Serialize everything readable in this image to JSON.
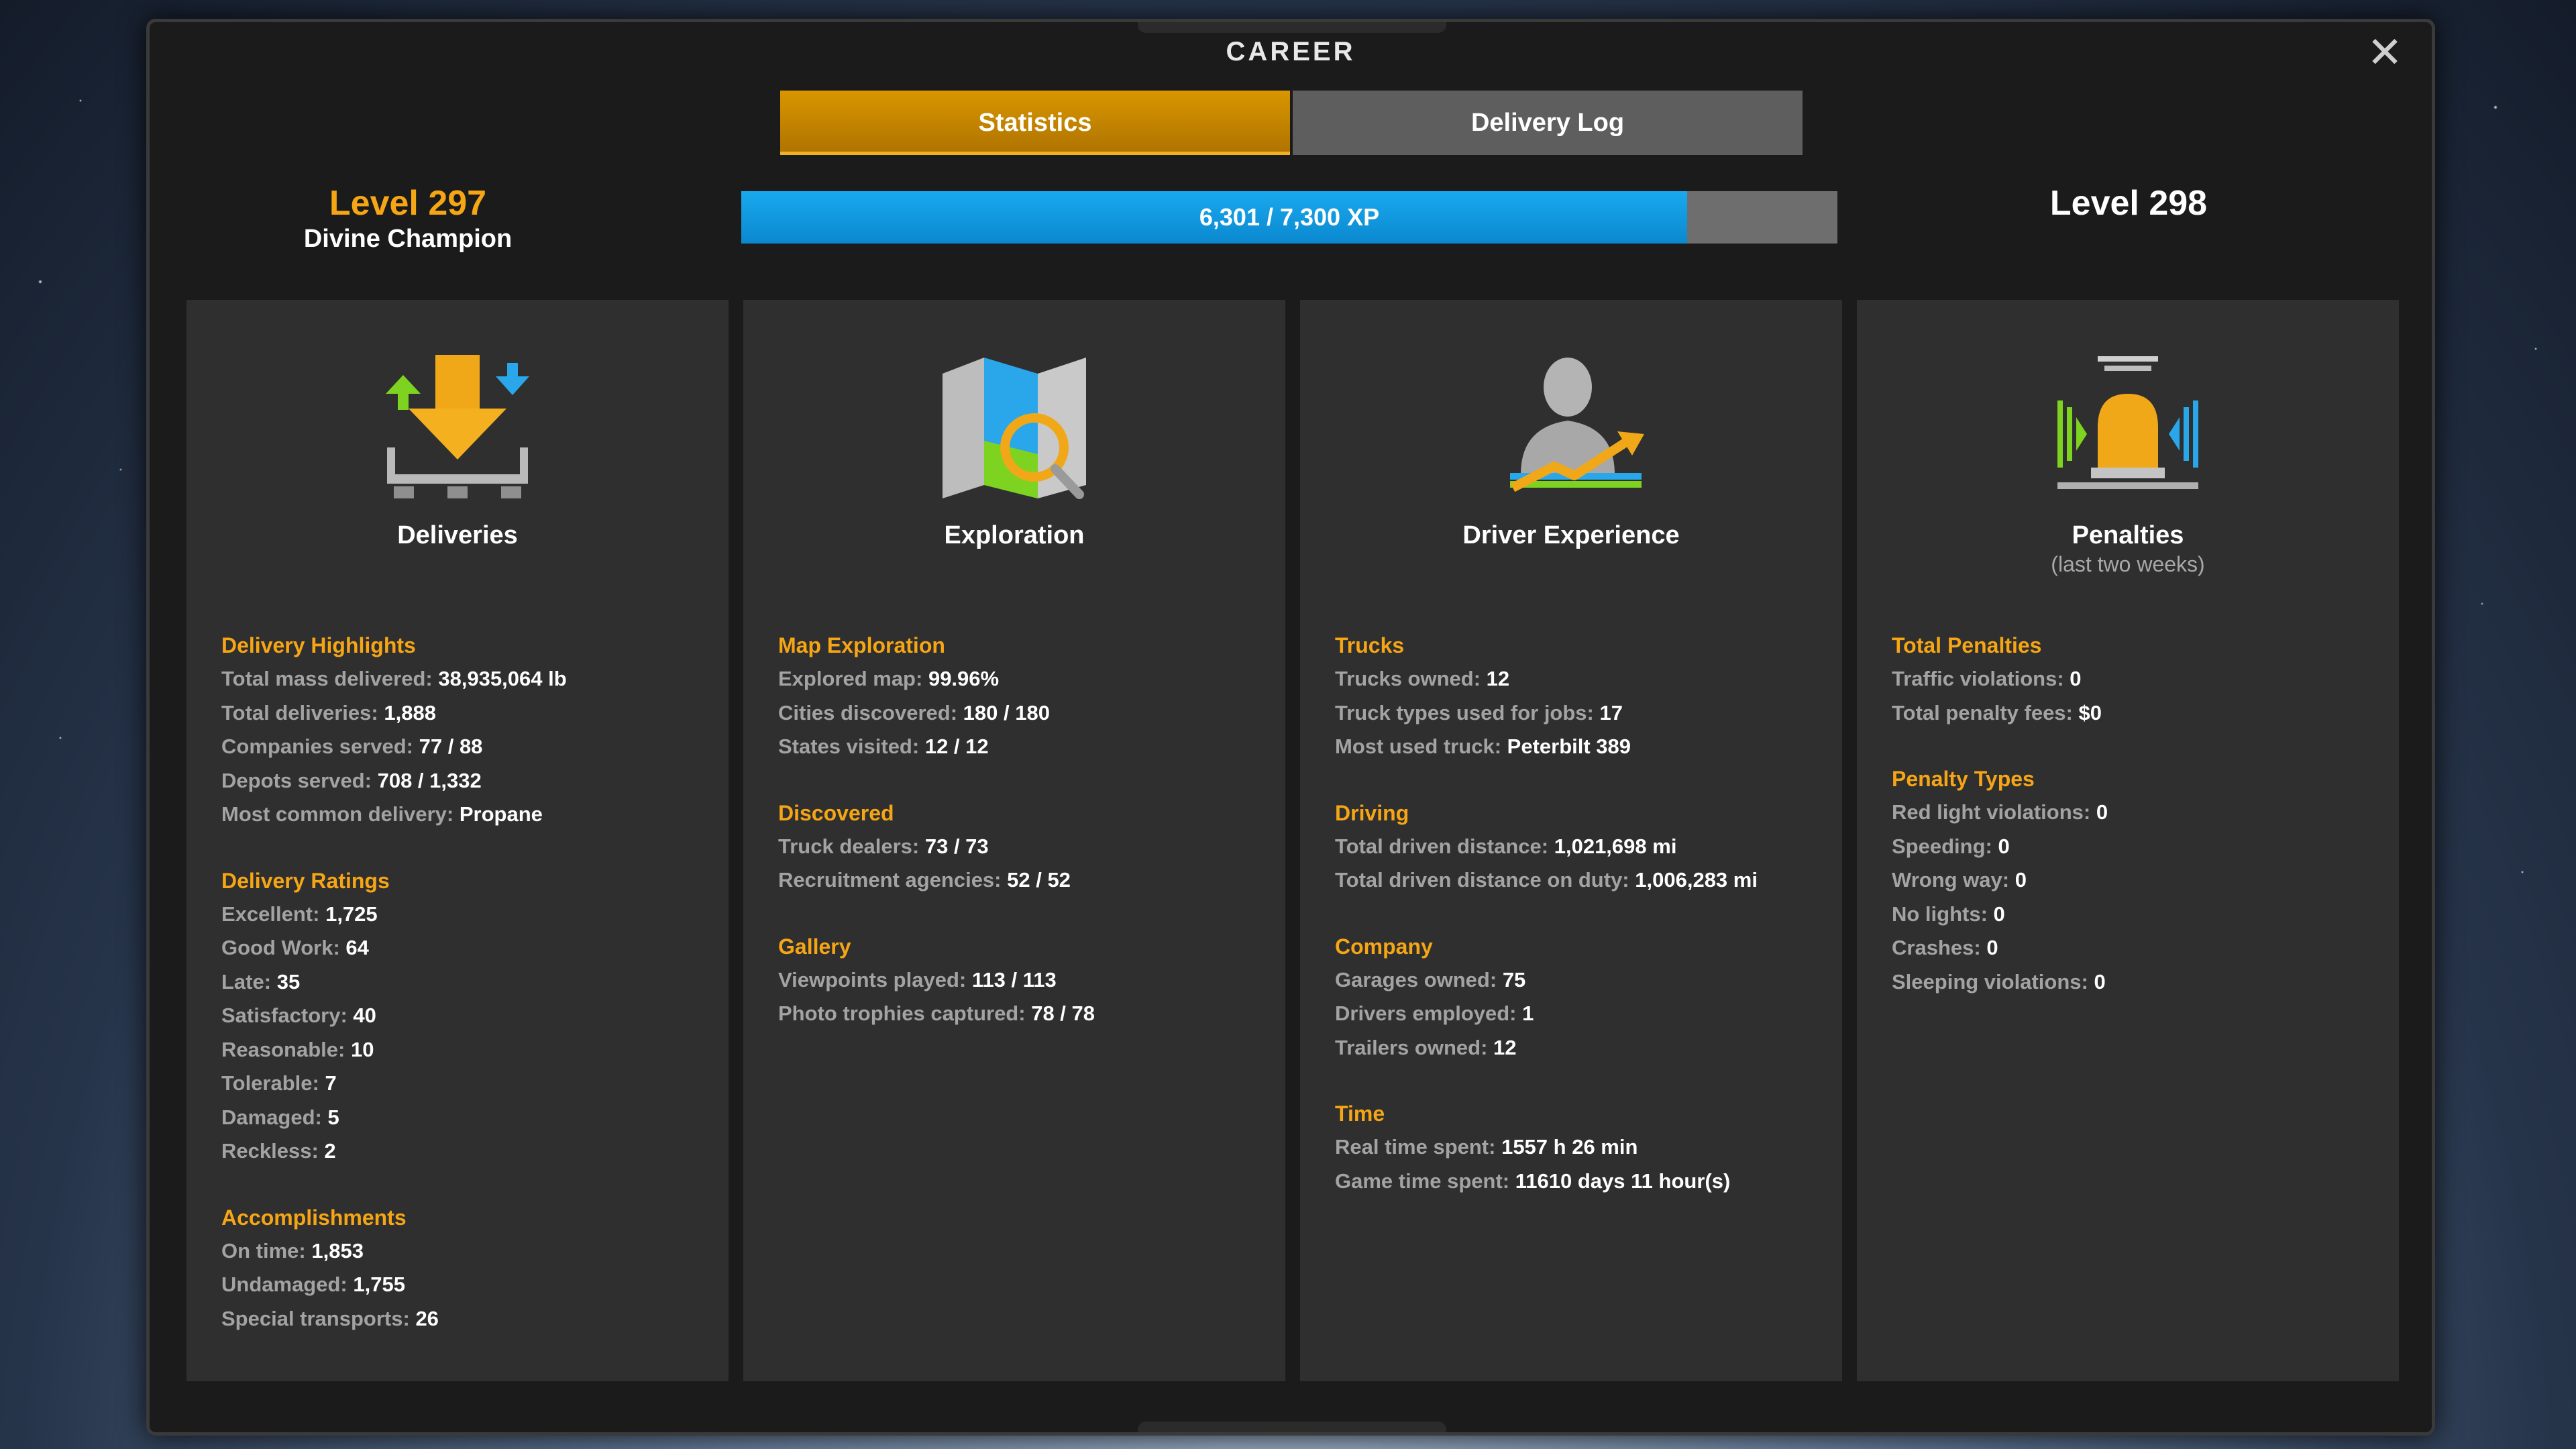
{
  "window": {
    "title": "CAREER",
    "close_icon": "close-icon"
  },
  "tabs": [
    {
      "label": "Statistics",
      "active": true
    },
    {
      "label": "Delivery Log",
      "active": false
    }
  ],
  "level": {
    "current": "Level 297",
    "rank": "Divine Champion",
    "next": "Level 298",
    "xp_text": "6,301 / 7,300 XP",
    "xp_fraction": 0.8632
  },
  "colors": {
    "accent": "#f6a615",
    "xp_blue": "#0b9be0",
    "panel": "#2f2f2f"
  },
  "panels": [
    {
      "title": "Deliveries",
      "subtitle": "",
      "icon": "deliveries-icon",
      "sections": [
        {
          "heading": "Delivery Highlights",
          "rows": [
            {
              "label": "Total mass delivered:",
              "value": "38,935,064 lb"
            },
            {
              "label": "Total deliveries:",
              "value": "1,888"
            },
            {
              "label": "Companies served:",
              "value": "77 / 88"
            },
            {
              "label": "Depots served:",
              "value": "708 / 1,332"
            },
            {
              "label": "Most common delivery:",
              "value": "Propane"
            }
          ]
        },
        {
          "heading": "Delivery Ratings",
          "rows": [
            {
              "label": "Excellent:",
              "value": "1,725"
            },
            {
              "label": "Good Work:",
              "value": "64"
            },
            {
              "label": "Late:",
              "value": "35"
            },
            {
              "label": "Satisfactory:",
              "value": "40"
            },
            {
              "label": "Reasonable:",
              "value": "10"
            },
            {
              "label": "Tolerable:",
              "value": "7"
            },
            {
              "label": "Damaged:",
              "value": "5"
            },
            {
              "label": "Reckless:",
              "value": "2"
            }
          ]
        },
        {
          "heading": "Accomplishments",
          "rows": [
            {
              "label": "On time:",
              "value": "1,853"
            },
            {
              "label": "Undamaged:",
              "value": "1,755"
            },
            {
              "label": "Special transports:",
              "value": "26"
            }
          ]
        }
      ]
    },
    {
      "title": "Exploration",
      "subtitle": "",
      "icon": "map-magnifier-icon",
      "sections": [
        {
          "heading": "Map Exploration",
          "rows": [
            {
              "label": "Explored map:",
              "value": "99.96%"
            },
            {
              "label": "Cities discovered:",
              "value": "180 / 180"
            },
            {
              "label": "States visited:",
              "value": "12 / 12"
            }
          ]
        },
        {
          "heading": "Discovered",
          "rows": [
            {
              "label": "Truck dealers:",
              "value": "73 / 73"
            },
            {
              "label": "Recruitment agencies:",
              "value": "52 / 52"
            }
          ]
        },
        {
          "heading": "Gallery",
          "rows": [
            {
              "label": "Viewpoints played:",
              "value": "113 / 113"
            },
            {
              "label": "Photo trophies captured:",
              "value": "78 / 78"
            }
          ]
        }
      ]
    },
    {
      "title": "Driver Experience",
      "subtitle": "",
      "icon": "driver-growth-icon",
      "sections": [
        {
          "heading": "Trucks",
          "rows": [
            {
              "label": "Trucks owned:",
              "value": "12"
            },
            {
              "label": "Truck types used for jobs:",
              "value": "17"
            },
            {
              "label": "Most used truck:",
              "value": "Peterbilt 389"
            }
          ]
        },
        {
          "heading": "Driving",
          "rows": [
            {
              "label": "Total driven distance:",
              "value": "1,021,698 mi"
            },
            {
              "label": "Total driven distance on duty:",
              "value": "1,006,283 mi"
            }
          ]
        },
        {
          "heading": "Company",
          "rows": [
            {
              "label": "Garages owned:",
              "value": "75"
            },
            {
              "label": "Drivers employed:",
              "value": "1"
            },
            {
              "label": "Trailers owned:",
              "value": "12"
            }
          ]
        },
        {
          "heading": "Time",
          "rows": [
            {
              "label": "Real time spent:",
              "value": "1557 h 26 min"
            },
            {
              "label": "Game time spent:",
              "value": "11610 days 11 hour(s)"
            }
          ]
        }
      ]
    },
    {
      "title": "Penalties",
      "subtitle": "(last two weeks)",
      "icon": "siren-icon",
      "sections": [
        {
          "heading": "Total Penalties",
          "rows": [
            {
              "label": "Traffic violations:",
              "value": "0"
            },
            {
              "label": "Total penalty fees:",
              "value": "$0"
            }
          ]
        },
        {
          "heading": "Penalty Types",
          "rows": [
            {
              "label": "Red light violations:",
              "value": "0"
            },
            {
              "label": "Speeding:",
              "value": "0"
            },
            {
              "label": "Wrong way:",
              "value": "0"
            },
            {
              "label": "No lights:",
              "value": "0"
            },
            {
              "label": "Crashes:",
              "value": "0"
            },
            {
              "label": "Sleeping violations:",
              "value": "0"
            }
          ]
        }
      ]
    }
  ]
}
